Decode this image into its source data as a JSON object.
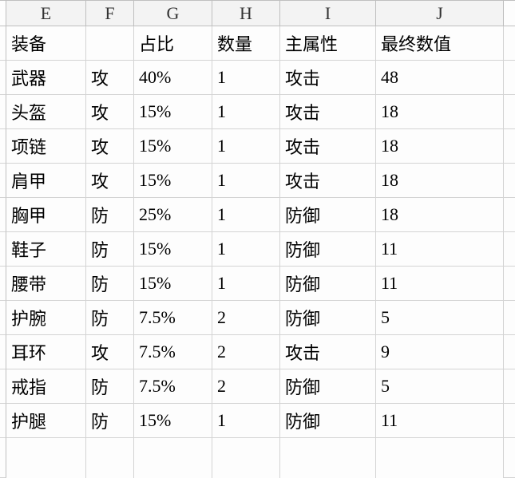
{
  "columns": [
    "E",
    "F",
    "G",
    "H",
    "I",
    "J"
  ],
  "header_row": {
    "e": "装备",
    "f": "",
    "g": "占比",
    "h": "数量",
    "i": "主属性",
    "j": "最终数值"
  },
  "rows": [
    {
      "e": "武器",
      "f": "攻",
      "g": "40%",
      "h": "1",
      "i": "攻击",
      "j": "48"
    },
    {
      "e": "头盔",
      "f": "攻",
      "g": "15%",
      "h": "1",
      "i": "攻击",
      "j": "18"
    },
    {
      "e": "项链",
      "f": "攻",
      "g": "15%",
      "h": "1",
      "i": "攻击",
      "j": "18"
    },
    {
      "e": "肩甲",
      "f": "攻",
      "g": "15%",
      "h": "1",
      "i": "攻击",
      "j": "18"
    },
    {
      "e": "胸甲",
      "f": "防",
      "g": "25%",
      "h": "1",
      "i": "防御",
      "j": "18"
    },
    {
      "e": "鞋子",
      "f": "防",
      "g": "15%",
      "h": "1",
      "i": "防御",
      "j": "11"
    },
    {
      "e": "腰带",
      "f": "防",
      "g": "15%",
      "h": "1",
      "i": "防御",
      "j": "11"
    },
    {
      "e": "护腕",
      "f": "防",
      "g": "7.5%",
      "h": "2",
      "i": "防御",
      "j": "5"
    },
    {
      "e": "耳环",
      "f": "攻",
      "g": "7.5%",
      "h": "2",
      "i": "攻击",
      "j": "9"
    },
    {
      "e": "戒指",
      "f": "防",
      "g": "7.5%",
      "h": "2",
      "i": "防御",
      "j": "5"
    },
    {
      "e": "护腿",
      "f": "防",
      "g": "15%",
      "h": "1",
      "i": "防御",
      "j": "11"
    }
  ]
}
